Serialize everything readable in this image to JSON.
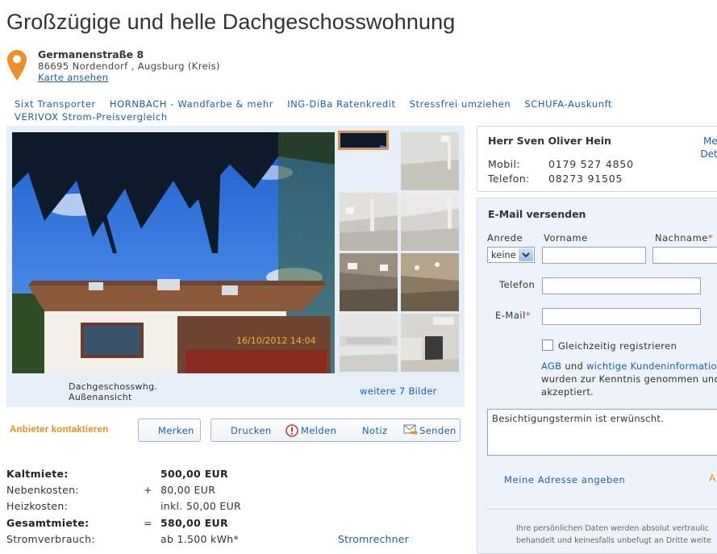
{
  "listing": {
    "title": "Großzügige und helle Dachgeschosswohnung",
    "street": "Germanenstraße 8",
    "city": "86695 Nordendorf , Augsburg (Kreis)",
    "map_link": "Karte ansehen"
  },
  "ads": [
    "Sixt Transporter",
    "HORNBACH - Wandfarbe & mehr",
    "ING-DiBa Ratenkredit",
    "Stressfrei umziehen",
    "SCHUFA-Auskunft",
    "VERIVOX Strom-Preisvergleich"
  ],
  "gallery": {
    "timestamp": "16/10/2012 14:04",
    "caption_line1": "Dachgeschosswhg.",
    "caption_line2": "Außenansicht",
    "more_link": "weitere 7 Bilder"
  },
  "actions": {
    "contact_label": "Anbieter kontaktieren",
    "remember": "Merken",
    "print": "Drucken",
    "report": "Melden",
    "note": "Notiz",
    "send": "Senden"
  },
  "costs": [
    {
      "label": "Kaltmiete:",
      "op": "",
      "value": "500,00 EUR",
      "bold": true
    },
    {
      "label": "Nebenkosten:",
      "op": "+",
      "value": "80,00 EUR",
      "bold": false
    },
    {
      "label": "Heizkosten:",
      "op": "",
      "value": "inkl. 50,00 EUR",
      "bold": false
    },
    {
      "label": "Gesamtmiete:",
      "op": "=",
      "value": "580,00 EUR",
      "bold": true
    },
    {
      "label": "Stromverbrauch:",
      "op": "",
      "value": "ab 1.500 kWh*",
      "bold": false
    }
  ],
  "power_calc_link": "Stromrechner",
  "agent": {
    "name": "Herr Sven Oliver Hein",
    "more_line1": "Me",
    "more_line2": "Det",
    "mobile_label": "Mobil:",
    "mobile": "0179 527 4850",
    "phone_label": "Telefon:",
    "phone": "08273 91505"
  },
  "form": {
    "heading": "E-Mail versenden",
    "salutation_label": "Anrede",
    "salutation_value": "keine",
    "firstname_label": "Vorname",
    "lastname_label": "Nachname",
    "phone_label": "Telefon",
    "email_label": "E-Mail",
    "required_mark": "*",
    "register_label": "Gleichzeitig registrieren",
    "agb_link": "AGB",
    "agb_and": " und ",
    "customer_info_link": "wichtige Kundeninformatio",
    "agb_line2": "wurden zur Kenntnis genommen und",
    "agb_line3": "akzeptiert.",
    "message": "Besichtigungstermin ist erwünscht.",
    "my_address_link": "Meine Adresse angeben",
    "cut_button": "A",
    "privacy_line1": "Ihre persönlichen Daten werden absolut vertraulic",
    "privacy_line2": "behandelt und keinesfalls unbefugt an Dritte weite"
  },
  "colors": {
    "accent_orange": "#f08c1a",
    "link_blue": "#1a5fb4",
    "panel_bg": "#e6eef8"
  }
}
